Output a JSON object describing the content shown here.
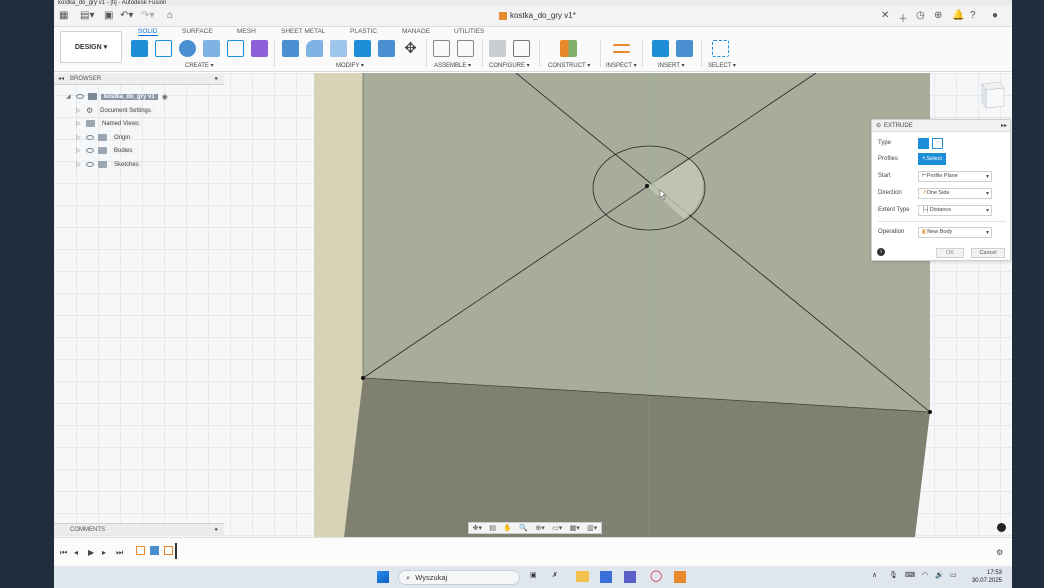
{
  "window": {
    "title": "kostka_do_gry v1 - [ti] - Autodesk Fusion",
    "document_tab": "kostka_do_gry v1*"
  },
  "ribbon": {
    "workspace": "DESIGN ▾",
    "tabs": [
      "SOLID",
      "SURFACE",
      "MESH",
      "SHEET METAL",
      "PLASTIC",
      "MANAGE",
      "UTILITIES"
    ],
    "active_tab": "SOLID",
    "groups": [
      "CREATE ▾",
      "MODIFY ▾",
      "ASSEMBLE ▾",
      "CONFIGURE ▾",
      "CONSTRUCT ▾",
      "INSPECT ▾",
      "INSERT ▾",
      "SELECT ▾"
    ]
  },
  "browser": {
    "title": "BROWSER",
    "root": "kostka_do_gry v1",
    "items": [
      {
        "label": "Document Settings",
        "icon": "gear-icon"
      },
      {
        "label": "Named Views",
        "icon": "folder-icon"
      },
      {
        "label": "Origin",
        "icon": "folder-icon"
      },
      {
        "label": "Bodies",
        "icon": "folder-icon"
      },
      {
        "label": "Sketches",
        "icon": "folder-icon"
      }
    ]
  },
  "extrude": {
    "title": "EXTRUDE",
    "rows": [
      {
        "label": "Type",
        "value": ""
      },
      {
        "label": "Profiles",
        "value": "Select"
      },
      {
        "label": "Start",
        "value": "Profile Plane"
      },
      {
        "label": "Direction",
        "value": "One Side"
      },
      {
        "label": "Extent Type",
        "value": "Distance"
      },
      {
        "label": "Operation",
        "value": "New Body"
      }
    ],
    "ok": "OK",
    "cancel": "Cancel"
  },
  "comments": {
    "title": "COMMENTS"
  },
  "taskbar": {
    "search_placeholder": "Wyszukaj",
    "time": "17:53",
    "date": "30.07.2025"
  },
  "colors": {
    "accent": "#1e8ed8",
    "face_top": "#a8ad9b",
    "face_front": "#7f806f",
    "face_side": "#d8d2b6"
  }
}
